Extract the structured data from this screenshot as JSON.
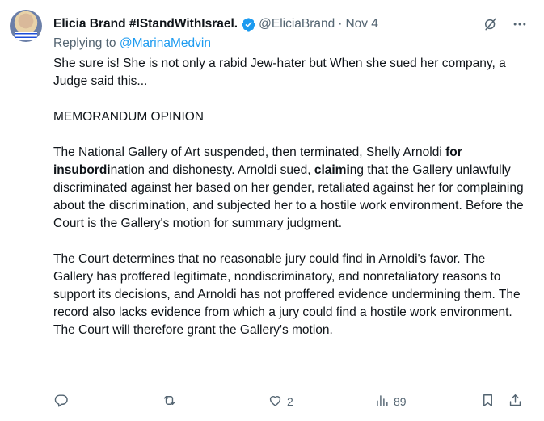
{
  "tweet": {
    "display_name": "Elicia Brand #IStandWithIsrael.",
    "handle": "@EliciaBrand",
    "separator": "·",
    "date": "Nov 4",
    "reply_prefix": "Replying to ",
    "reply_to": "@MarinaMedvin",
    "body": {
      "p1": "She sure is!  She is not only a rabid Jew-hater but    When she sued her company, a Judge said this...",
      "p2": "MEMORANDUM OPINION",
      "p3_a": "The National Gallery of Art suspended, then terminated, Shelly Arnoldi ",
      "p3_b1": "for",
      "p3_c": " ",
      "p3_b2": "in",
      "p3_d": "",
      "p3_b3": "subordi",
      "p3_e": "nation and dishonesty. Arnoldi sued, ",
      "p3_b4": "claimi",
      "p3_f": "ng that the Gallery unlawfully discriminated against her based on her gender, retaliated against her for complaining about the discrimination, and subjected her to a hostile work environment. Before the Court is the Gallery's motion for summary judgment.",
      "p4": "The Court determines that no reasonable jury could find in Arnoldi's favor. The Gallery has proffered legitimate, nondiscriminatory, and nonretaliatory reasons to support its decisions, and Arnoldi has not proffered evidence undermining them. The record also lacks evidence from which a jury could find a hostile work environment. The Court will therefore grant the Gallery's motion."
    },
    "metrics": {
      "replies": "",
      "reposts": "",
      "likes": "2",
      "views": "89"
    }
  },
  "colors": {
    "text": "#0f1419",
    "muted": "#536471",
    "link": "#1d9bf0",
    "verified": "#1d9bf0"
  },
  "icons": [
    "verified-badge-icon",
    "grok-icon",
    "more-icon",
    "reply-icon",
    "repost-icon",
    "like-icon",
    "views-icon",
    "bookmark-icon",
    "share-icon"
  ]
}
